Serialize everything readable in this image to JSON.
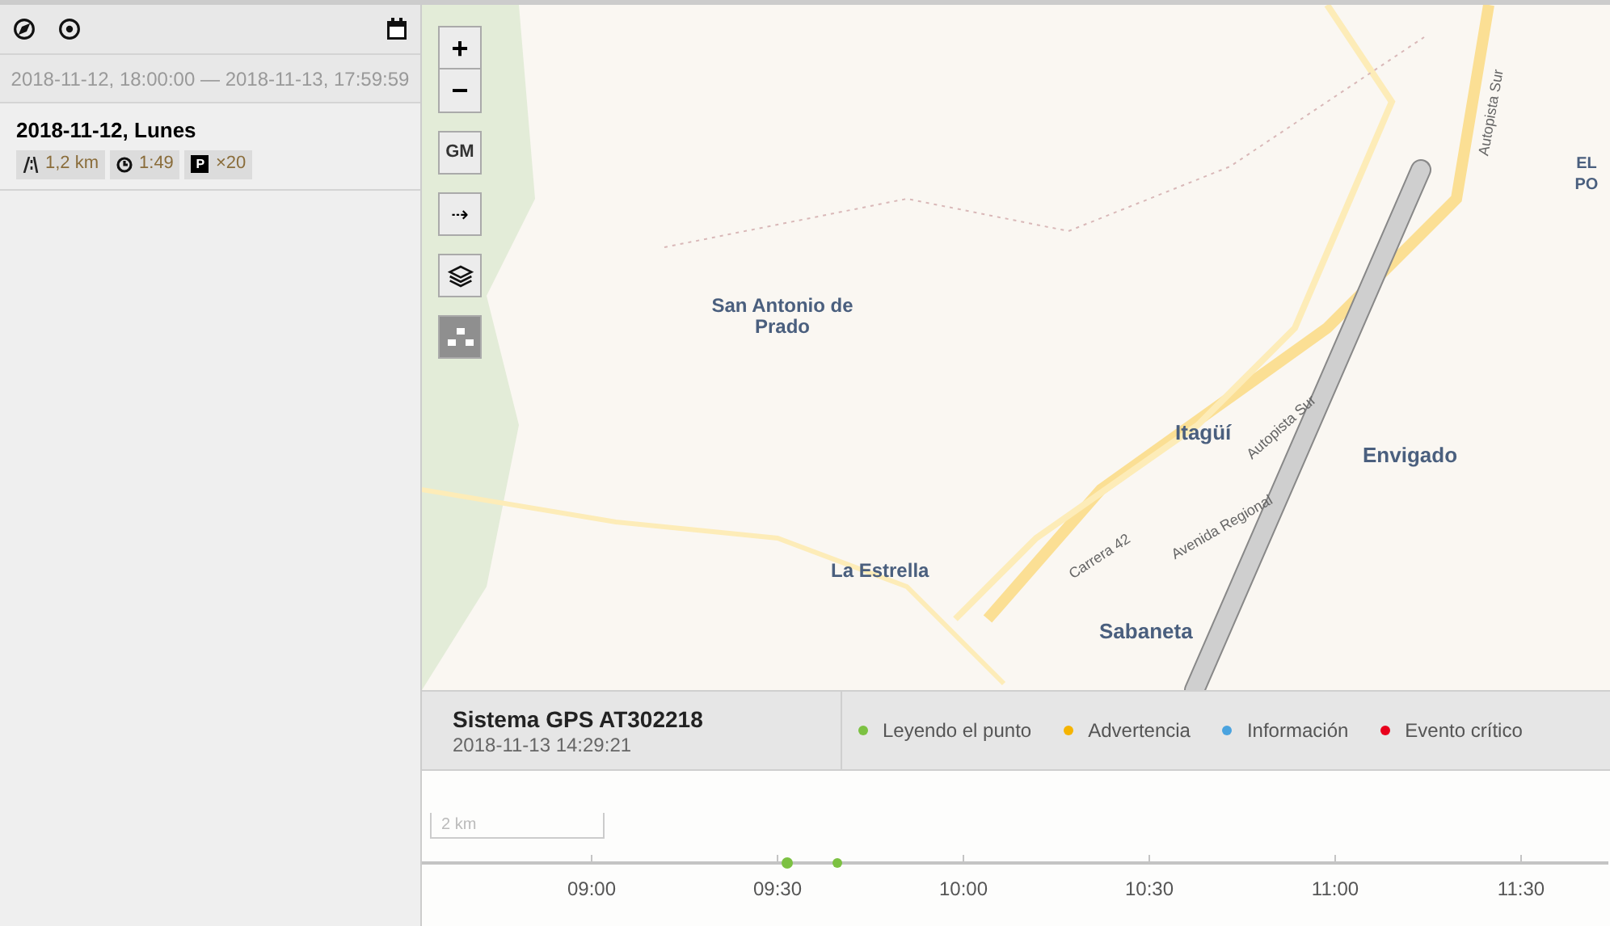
{
  "sidebar": {
    "range": "2018-11-12, 18:00:00 — 2018-11-13, 17:59:59",
    "days": [
      {
        "title": "2018-11-12, Lunes",
        "distance": "1,2 km",
        "duration": "1:49",
        "stops_badge": "P",
        "stops": "×20"
      }
    ]
  },
  "map_controls": {
    "zoom_in": "+",
    "zoom_out": "−",
    "provider": "GM",
    "arrow": "⇢",
    "toggles": [
      {
        "kind": "layers",
        "selected": false
      },
      {
        "kind": "points",
        "selected": true
      }
    ]
  },
  "map_labels": [
    {
      "text": "San Antonio de Prado",
      "kind": "town"
    },
    {
      "text": "Itagüí",
      "kind": "city"
    },
    {
      "text": "Envigado",
      "kind": "city"
    },
    {
      "text": "La Estrella",
      "kind": "town"
    },
    {
      "text": "Sabaneta",
      "kind": "city"
    },
    {
      "text": "EL PO",
      "kind": "district"
    },
    {
      "text": "Autopista Sur",
      "kind": "road"
    },
    {
      "text": "Autopista Sur",
      "kind": "road"
    },
    {
      "text": "Carrera 42",
      "kind": "road"
    },
    {
      "text": "Avenida Regional",
      "kind": "road"
    }
  ],
  "device": {
    "name": "Sistema GPS AT302218",
    "time": "2018-11-13 14:29:21"
  },
  "legend": [
    {
      "label": "Leyendo el punto",
      "color": "#7cc142"
    },
    {
      "label": "Advertencia",
      "color": "#f5b400"
    },
    {
      "label": "Información",
      "color": "#4aa3df"
    },
    {
      "label": "Evento crítico",
      "color": "#e8001c"
    }
  ],
  "scale": "2 km",
  "timeline": {
    "ticks": [
      "09:00",
      "09:30",
      "10:00",
      "10:30",
      "11:00",
      "11:30"
    ]
  }
}
